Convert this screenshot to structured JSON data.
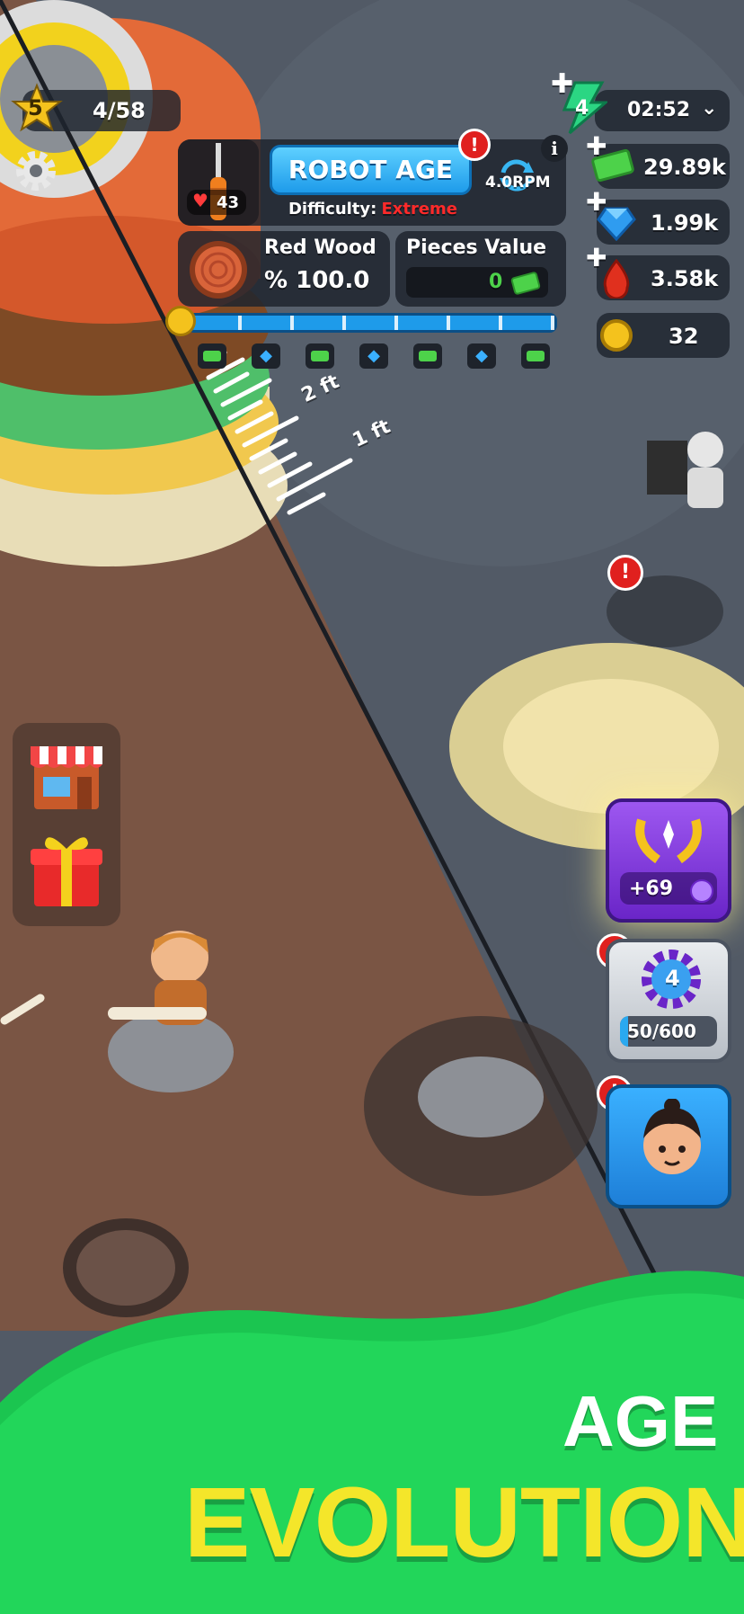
{
  "player": {
    "level": "5",
    "progress": "4/58"
  },
  "top_panel": {
    "era_title": "ROBOT AGE",
    "difficulty_label": "Difficulty:",
    "difficulty_value": "Extreme",
    "rpm": "4.0RPM",
    "info_symbol": "i",
    "alert_symbol": "!",
    "tool_hp": "43",
    "material_name": "Red Wood",
    "material_percent": "% 100.0",
    "pieces_value_label": "Pieces Value",
    "pieces_value": "0",
    "progress_fraction": 0.0
  },
  "ruler": {
    "marks": [
      "2 ft",
      "1 ft"
    ]
  },
  "resources": {
    "timer": "02:52",
    "energy": "4",
    "cash": "29.89k",
    "gems": "1.99k",
    "blood": "3.58k",
    "coins": "32"
  },
  "rank_card": {
    "bonus": "+69"
  },
  "level_card": {
    "level": "4",
    "progress": "50/600",
    "fraction": 0.083
  },
  "banner": {
    "line1": "AGE",
    "line2": "EVOLUTION"
  },
  "colors": {
    "accent_blue": "#2aa9f0",
    "banner_green": "#22d65a",
    "banner_yellow": "#f4e62a",
    "cash_green": "#4dd24a",
    "extreme_red": "#ff2a2a"
  },
  "icons": [
    "star-icon",
    "gear-icon",
    "screwdriver-icon",
    "heart-icon",
    "rotate-icon",
    "wood-log-icon",
    "cash-icon",
    "gem-icon",
    "blood-drop-icon",
    "coin-icon",
    "energy-icon",
    "chevron-down-icon",
    "shop-icon",
    "gift-icon",
    "laurel-icon",
    "avatar-icon"
  ]
}
